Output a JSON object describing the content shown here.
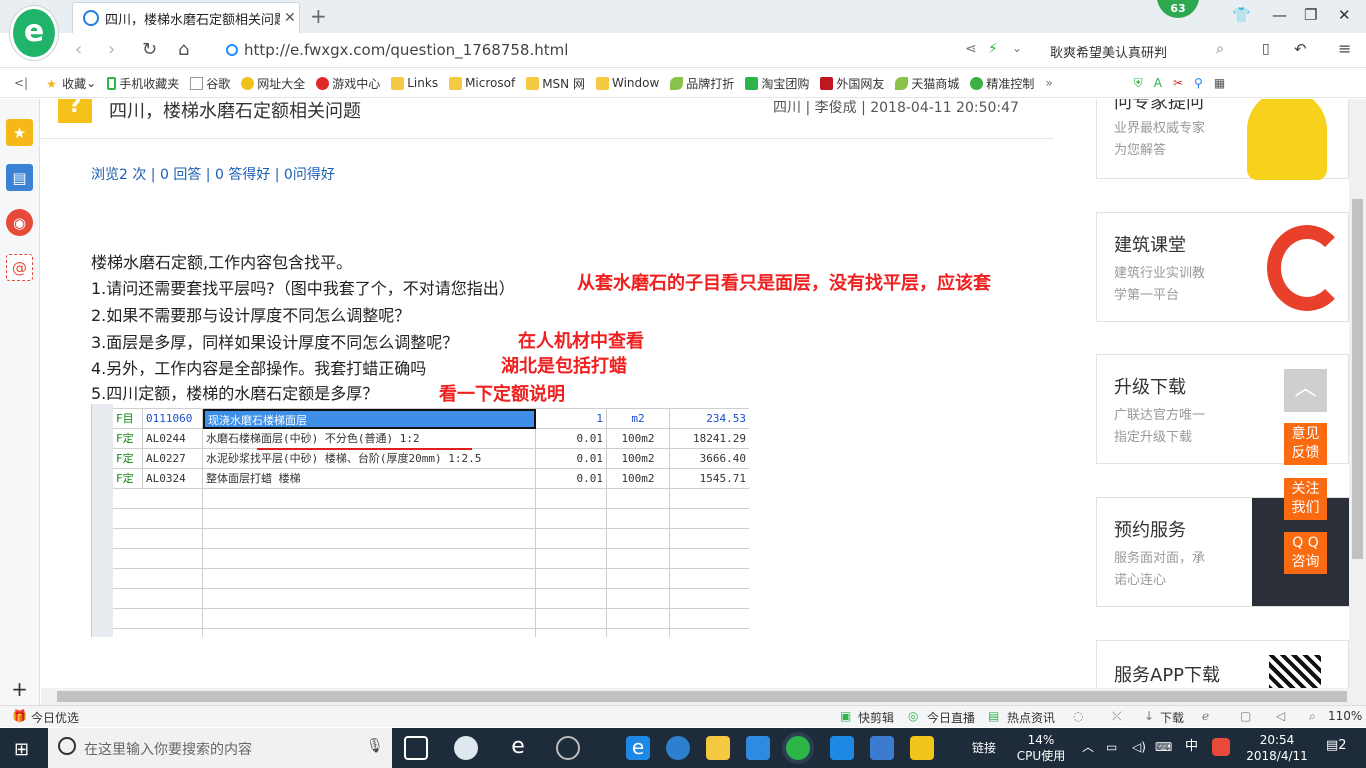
{
  "browser": {
    "tab_title": "四川，楼梯水磨石定额相关问题_",
    "notification_count": "63",
    "url": "http://e.fwxgx.com/question_1768758.html",
    "search_hint": "耿爽希望美认真研判"
  },
  "bookmarks": [
    "收藏",
    "手机收藏夹",
    "谷歌",
    "网址大全",
    "游戏中心",
    "Links",
    "Microsof",
    "MSN 网",
    "Window",
    "品牌打折",
    "淘宝团购",
    "外国网友",
    "天猫商城",
    "精准控制"
  ],
  "question": {
    "icon": "?",
    "title": "四川，楼梯水磨石定额相关问题",
    "meta": "四川 | 李俊成 | 2018-04-11 20:50:47",
    "stats": "浏览2 次 | 0 回答 | 0 答得好 | 0问得好",
    "lines": [
      "楼梯水磨石定额,工作内容包含找平。",
      "1.请问还需要套找平层吗?（图中我套了个，不对请您指出）",
      "2.如果不需要那与设计厚度不同怎么调整呢？",
      "3.面层是多厚，同样如果设计厚度不同怎么调整呢？",
      "4.另外，工作内容是全部操作。我套打蜡正确吗",
      "5.四川定额，楼梯的水磨石定额是多厚？"
    ],
    "annotations": [
      "从套水磨石的子目看只是面层，没有找平层，应该套",
      "在人机材中查看",
      "湖北是包括打蜡",
      "看一下定额说明"
    ]
  },
  "sheet": {
    "rows": [
      {
        "type": "F目",
        "code": "0111060",
        "name": "现浇水磨石楼梯面层",
        "qty": "1",
        "unit": "m2",
        "price": "234.53"
      },
      {
        "type": "F定",
        "code": "AL0244",
        "name": "水磨石楼梯面层(中砂) 不分色(普通) 1:2",
        "qty": "0.01",
        "unit": "100m2",
        "price": "18241.29"
      },
      {
        "type": "F定",
        "code": "AL0227",
        "name": "水泥砂浆找平层(中砂) 楼梯、台阶(厚度20mm) 1:2.5",
        "qty": "0.01",
        "unit": "100m2",
        "price": "3666.40"
      },
      {
        "type": "F定",
        "code": "AL0324",
        "name": "整体面层打蜡 楼梯",
        "qty": "0.01",
        "unit": "100m2",
        "price": "1545.71"
      }
    ]
  },
  "ads": [
    {
      "title": "问专家提问",
      "sub1": "业界最权威专家",
      "sub2": "为您解答"
    },
    {
      "title": "建筑课堂",
      "sub1": "建筑行业实训教",
      "sub2": "学第一平台"
    },
    {
      "title": "升级下载",
      "sub1": "广联达官方唯一",
      "sub2": "指定升级下载"
    },
    {
      "title": "预约服务",
      "sub1": "服务面对面，承",
      "sub2": "诺心连心"
    },
    {
      "title": "服务APP下载",
      "sub1": "",
      "sub2": ""
    }
  ],
  "floating": [
    "意见\n反馈",
    "关注\n我们",
    "Q Q\n咨询"
  ],
  "statusbar": {
    "left": "今日优选",
    "items": [
      "快剪辑",
      "今日直播",
      "热点资讯",
      "下载"
    ],
    "zoom": "110%"
  },
  "taskbar": {
    "search_placeholder": "在这里输入你要搜索的内容",
    "link": "链接",
    "cpu_pct": "14%",
    "cpu_label": "CPU使用",
    "ime": "中",
    "time": "20:54",
    "date": "2018/4/11",
    "notifications": "2"
  }
}
